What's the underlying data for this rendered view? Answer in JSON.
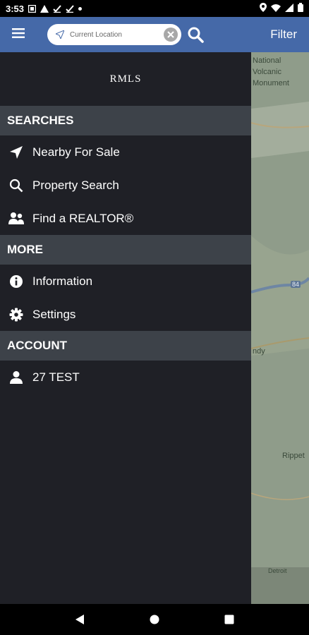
{
  "status_bar": {
    "time": "3:53",
    "icons_left": [
      "notification-icon",
      "warning-icon",
      "check-icon",
      "check-icon",
      "dot-icon"
    ],
    "icons_right": [
      "location-icon",
      "wifi-icon",
      "signal-icon",
      "battery-icon"
    ]
  },
  "app_bar": {
    "background": "#4569a8",
    "search_placeholder": "Current Location",
    "filter_label": "Filter"
  },
  "drawer": {
    "logo": "RMLS",
    "sections": [
      {
        "title": "SEARCHES",
        "items": [
          {
            "label": "Nearby For Sale",
            "icon": "navigation-arrow-icon"
          },
          {
            "label": "Property Search",
            "icon": "search-icon"
          },
          {
            "label": "Find a REALTOR®",
            "icon": "people-icon"
          }
        ]
      },
      {
        "title": "MORE",
        "items": [
          {
            "label": "Information",
            "icon": "info-icon"
          },
          {
            "label": "Settings",
            "icon": "gear-icon"
          }
        ]
      },
      {
        "title": "ACCOUNT",
        "items": [
          {
            "label": "27 TEST",
            "icon": "person-icon"
          }
        ]
      }
    ]
  },
  "map": {
    "labels": [
      "National",
      "Volcanic",
      "Monument",
      "ndy",
      "Rippet",
      "Detroit"
    ],
    "highway_shield": "84"
  },
  "colors": {
    "drawer_bg": "#1f2026",
    "section_header_bg": "#3d4249",
    "map_bg": "#9aa996"
  }
}
